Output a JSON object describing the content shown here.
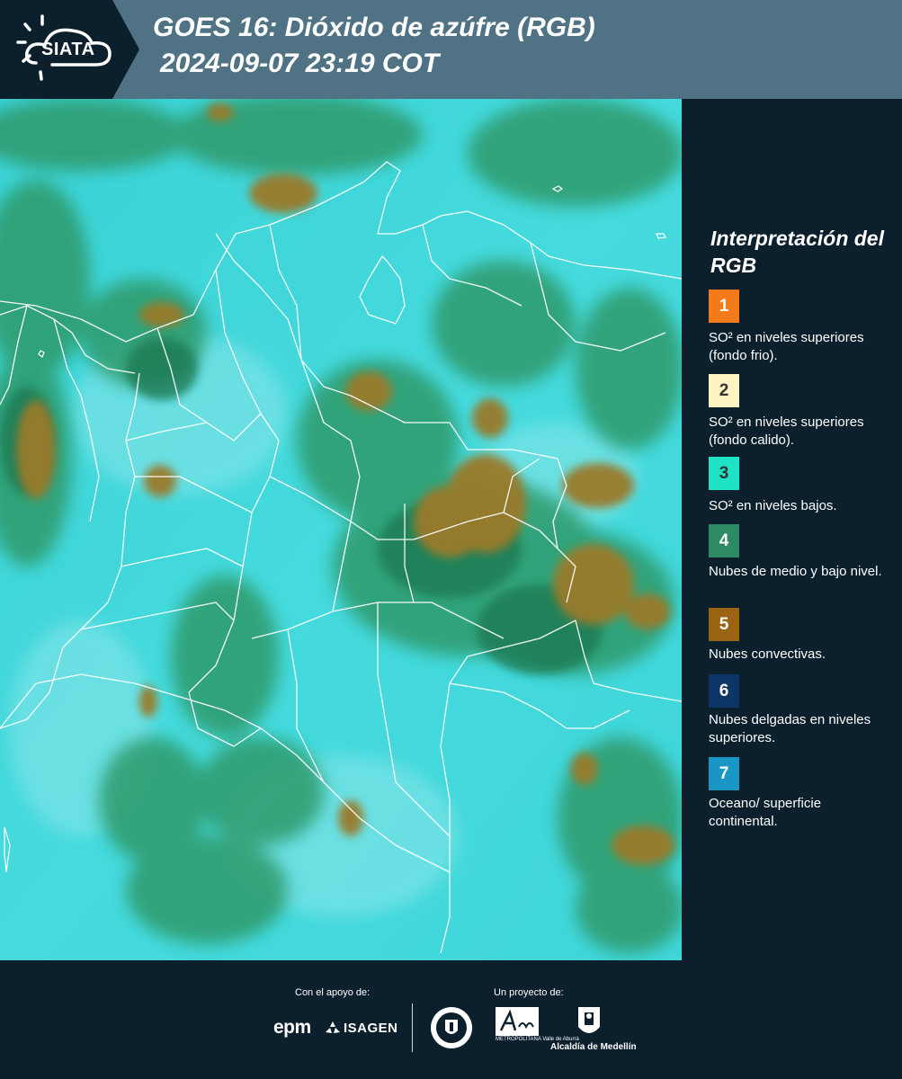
{
  "header": {
    "logo_text": "SIATA",
    "title_line1": "GOES 16: Dióxido de azúfre (RGB)",
    "title_line2": "2024-09-07 23:19 COT"
  },
  "legend": {
    "title": "Interpretación del RGB",
    "items": [
      {
        "number": "1",
        "color": "#f57a1a",
        "text": "SO² en niveles superiores (fondo frio)."
      },
      {
        "number": "2",
        "color": "#fdf3c3",
        "text": "SO² en niveles superiores (fondo calido)."
      },
      {
        "number": "3",
        "color": "#1ee3c6",
        "text": "SO² en niveles bajos."
      },
      {
        "number": "4",
        "color": "#2e8a62",
        "text": "Nubes de medio y bajo nivel."
      },
      {
        "number": "5",
        "color": "#9a6412",
        "text": "Nubes convectivas."
      },
      {
        "number": "6",
        "color": "#0d3566",
        "text": "Nubes delgadas en niveles superiores."
      },
      {
        "number": "7",
        "color": "#1a96c4",
        "text": "Oceano/ superficie continental."
      }
    ]
  },
  "footer": {
    "support_label": "Con el apoyo de:",
    "project_label": "Un proyecto de:",
    "brand_epm": "epm",
    "brand_isagen": "ISAGEN",
    "brand_area": "Área",
    "brand_area_sub": "METROPOLITANA Valle de Aburrá",
    "brand_medellin": "MEDELLÍN",
    "brand_alcaldia": "Alcaldía de Medellín"
  },
  "colors": {
    "header_bg": "#4f7384",
    "panel_bg": "#0c1f2c",
    "map_base": "#3fd7dc",
    "cloud_low": "#2f9a6a",
    "cloud_convective": "#9a7a2a"
  }
}
